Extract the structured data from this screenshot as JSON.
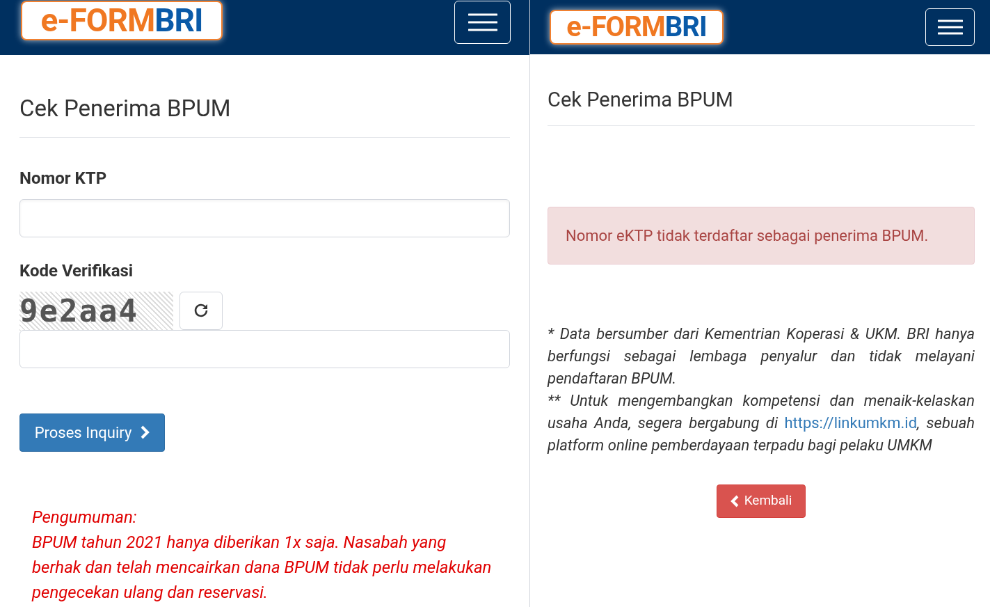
{
  "left": {
    "logo": {
      "part_1": "e-FORM",
      "part_2": "BRI"
    },
    "title": "Cek Penerima BPUM",
    "fields": [
      {
        "label": "Nomor KTP"
      },
      {
        "label": "Kode Verifikasi"
      }
    ],
    "captcha": "9e2aa4",
    "submit_button": "Proses Inquiry",
    "announcement": {
      "heading": "Pengumuman:",
      "body": "BPUM tahun 2021 hanya diberikan 1x saja. Nasabah yang berhak dan telah mencairkan dana BPUM tidak perlu melakukan pengecekan ulang dan reservasi."
    }
  },
  "right": {
    "logo": {
      "part_1": "e-FORM",
      "part_2": "BRI"
    },
    "title": "Cek Penerima BPUM",
    "alert": "Nomor eKTP tidak terdaftar sebagai penerima BPUM.",
    "note_1": "* Data bersumber dari Kementrian Koperasi & UKM. BRI hanya berfungsi sebagai lembaga penyalur dan tidak melayani pendaftaran BPUM.",
    "note_2": {
      "before": "** Untuk mengembangkan kompetensi dan menaik-kelaskan usaha Anda, segera bergabung di",
      "link": "https://linkumkm.id",
      "after": ", sebuah platform online pemberdayaan terpadu bagi pelaku UMKM"
    },
    "back_button": "Kembali"
  }
}
